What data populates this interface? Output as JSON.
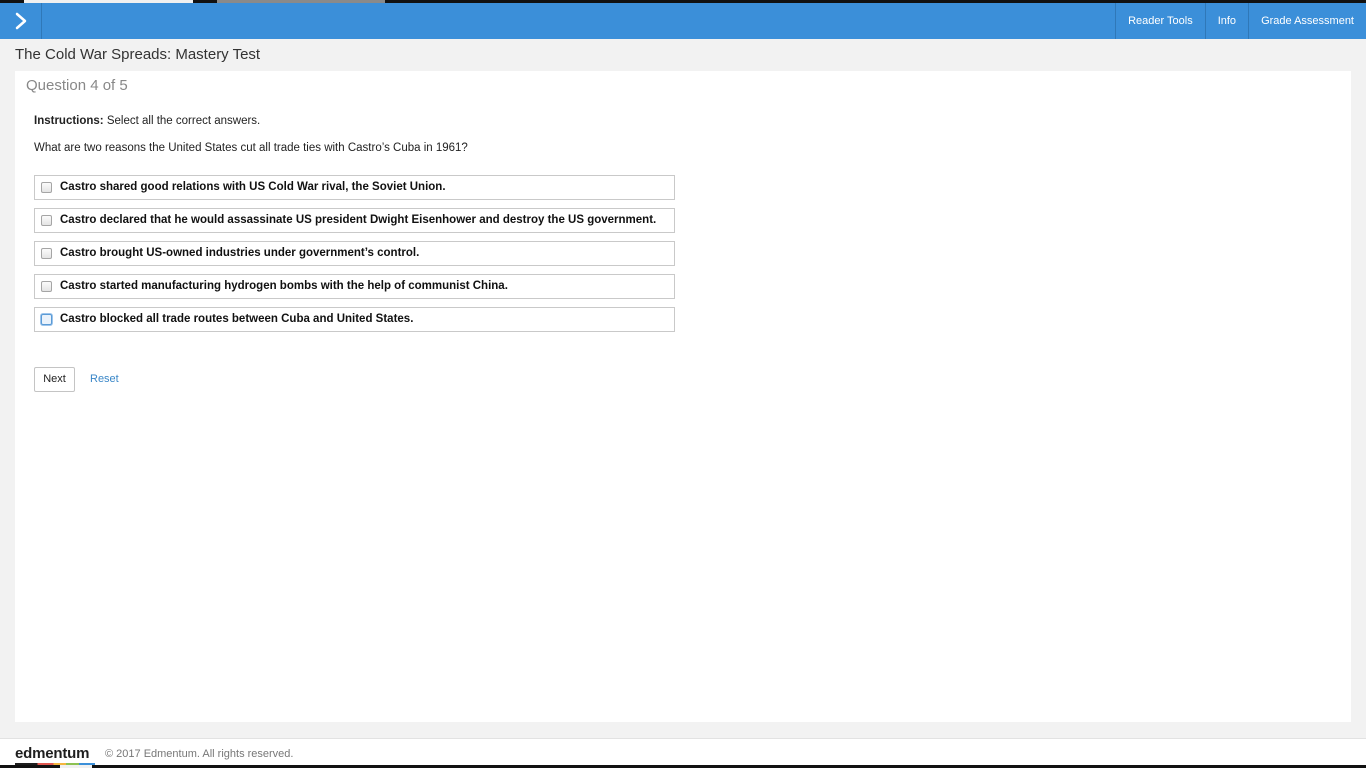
{
  "topbar": {
    "toggle_icon": "chevron-right-icon",
    "nav": [
      {
        "label": "Reader Tools"
      },
      {
        "label": "Info"
      },
      {
        "label": "Grade Assessment"
      }
    ]
  },
  "page": {
    "title": "The Cold War Spreads: Mastery Test"
  },
  "question": {
    "counter": "Question 4 of 5",
    "instructions_label": "Instructions:",
    "instructions_text": "Select all the correct answers.",
    "prompt": "What are two reasons the United States cut all trade ties with Castro’s Cuba in 1961?",
    "options": [
      {
        "label": "Castro shared good relations with US Cold War rival, the Soviet Union.",
        "checked": false
      },
      {
        "label": "Castro declared that he would assassinate US president Dwight Eisenhower and destroy the US government.",
        "checked": false
      },
      {
        "label": "Castro brought US-owned industries under government’s control.",
        "checked": false
      },
      {
        "label": "Castro started manufacturing hydrogen bombs with the help of communist China.",
        "checked": false
      },
      {
        "label": "Castro blocked all trade routes between Cuba and United States.",
        "checked": false
      }
    ]
  },
  "actions": {
    "next_label": "Next",
    "reset_label": "Reset"
  },
  "footer": {
    "logo_text": "edmentum",
    "copyright": "© 2017 Edmentum. All rights reserved."
  },
  "colors": {
    "topbar": "#3b8fd9",
    "link": "#3a87c8",
    "background": "#f2f2f2"
  }
}
